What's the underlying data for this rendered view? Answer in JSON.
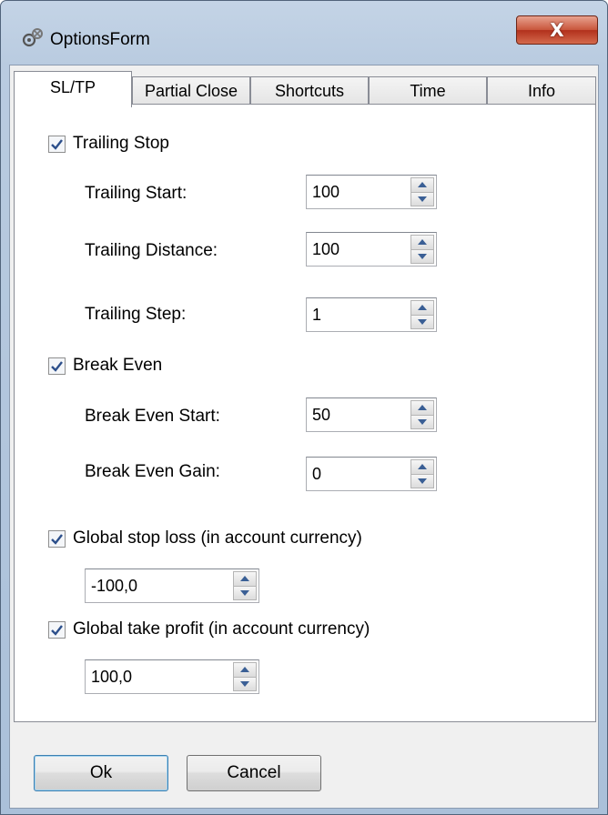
{
  "window": {
    "title": "OptionsForm",
    "close_glyph": "X"
  },
  "tabs": [
    {
      "label": "SL/TP",
      "active": true
    },
    {
      "label": "Partial Close",
      "active": false
    },
    {
      "label": "Shortcuts",
      "active": false
    },
    {
      "label": "Time",
      "active": false
    },
    {
      "label": "Info",
      "active": false
    }
  ],
  "trailing": {
    "checkbox_label": "Trailing Stop",
    "checked": true,
    "start_label": "Trailing Start:",
    "start_value": "100",
    "distance_label": "Trailing Distance:",
    "distance_value": "100",
    "step_label": "Trailing Step:",
    "step_value": "1"
  },
  "break_even": {
    "checkbox_label": "Break Even",
    "checked": true,
    "start_label": "Break Even Start:",
    "start_value": "50",
    "gain_label": "Break Even Gain:",
    "gain_value": "0"
  },
  "global_sl": {
    "checkbox_label": "Global stop loss (in account currency)",
    "checked": true,
    "value": "-100,0"
  },
  "global_tp": {
    "checkbox_label": "Global take profit (in account currency)",
    "checked": true,
    "value": "100,0"
  },
  "buttons": {
    "ok_label": "Ok",
    "cancel_label": "Cancel"
  },
  "icons": {
    "app": "gears-icon",
    "checkbox_check": "checkmark-icon",
    "spin_up": "triangle-up-icon",
    "spin_down": "triangle-down-icon"
  },
  "colors": {
    "title_gradient": "#b9cbe0",
    "close_button": "#c8553b",
    "checkmark": "#2c4f8b"
  }
}
